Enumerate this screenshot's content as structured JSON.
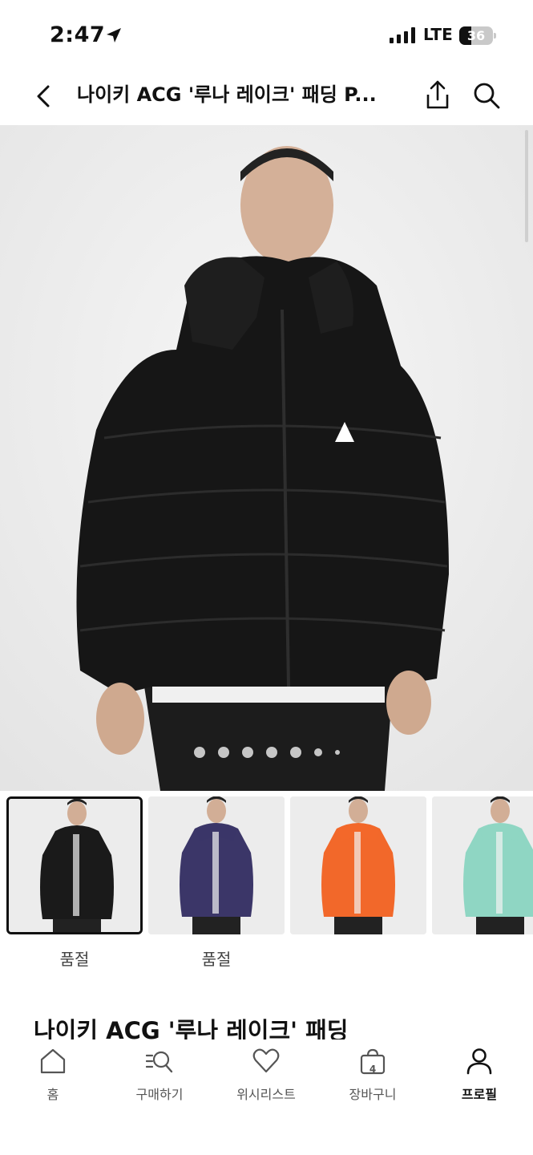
{
  "status_bar": {
    "time": "2:47",
    "network": "LTE",
    "battery": "36",
    "battery_level": 0.36
  },
  "header": {
    "title": "나이키 ACG '루나 레이크' 패딩 P...",
    "icons": [
      "back-chevron-icon",
      "share-icon",
      "search-icon"
    ]
  },
  "gallery": {
    "image_count": 7,
    "active_index": 0
  },
  "thumbnails": [
    {
      "color": "#1a1a1a",
      "selected": true,
      "label": "품절"
    },
    {
      "color": "#3b3668",
      "selected": false,
      "label": "품절"
    },
    {
      "color": "#f2682a",
      "selected": false,
      "label": ""
    },
    {
      "color": "#8fd6c3",
      "selected": false,
      "label": ""
    }
  ],
  "product": {
    "title": "나이키 ACG '루나 레이크' 패딩"
  },
  "bottom_nav": {
    "items": [
      {
        "label": "홈",
        "icon": "home-icon"
      },
      {
        "label": "구매하기",
        "icon": "search-list-icon"
      },
      {
        "label": "위시리스트",
        "icon": "heart-icon"
      },
      {
        "label": "장바구니",
        "icon": "cart-icon",
        "count": "4"
      },
      {
        "label": "프로필",
        "icon": "profile-icon",
        "active": true
      }
    ]
  }
}
